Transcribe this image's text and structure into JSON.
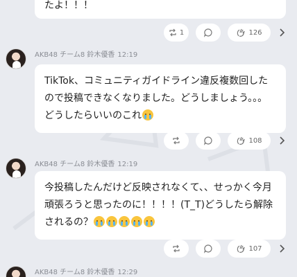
{
  "posts": [
    {
      "partial": true,
      "text_lines": [
        "たよ！！！"
      ],
      "reposts": "1",
      "likes": "126"
    },
    {
      "author": "AKB48 チーム8 鈴木優香",
      "time": "12:19",
      "text": "TikTok、コミュニティガイドライン違反複数回したので投稿できなくなりました。どうしましょう。。。どうしたらいいのこれ",
      "trailing_emoji": [
        "crying-face"
      ],
      "reposts": "",
      "likes": "108"
    },
    {
      "author": "AKB48 チーム8 鈴木優香",
      "time": "12:19",
      "text": "今投稿したんだけど反映されなくて、、せっかく今月頑張ろうと思ったのに！！！！(T_T)どうしたら解除されるの？",
      "trailing_emoji": [
        "crying-face",
        "crying-face",
        "crying-face",
        "crying-face",
        "crying-face"
      ],
      "reposts": "",
      "likes": "107"
    },
    {
      "author": "AKB48 チーム8 鈴木優香",
      "time": "12:29",
      "partial": true
    }
  ],
  "icons": {
    "repost": "repost-icon",
    "reply": "reply-bubble-icon",
    "like": "clap-icon",
    "more": "chevron-right-icon"
  },
  "colors": {
    "background": "#e9ebf0",
    "bubble": "#ffffff",
    "meta_text": "#8a8d94"
  }
}
